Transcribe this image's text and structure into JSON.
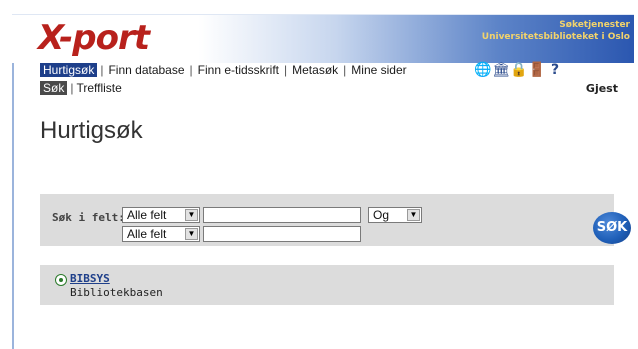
{
  "header": {
    "logo": "X-port",
    "org_line1": "Søketjenester",
    "org_line2": "Universitetsbiblioteket i Oslo"
  },
  "nav": {
    "items": [
      "Hurtigsøk",
      "Finn database",
      "Finn e-tidsskrift",
      "Metasøk",
      "Mine sider"
    ],
    "active": "Hurtigsøk",
    "icons": [
      "globe-icon",
      "library-icon",
      "lock-icon",
      "exit-door-icon",
      "help-icon"
    ]
  },
  "subnav": {
    "items": [
      "Søk",
      "Treffliste"
    ],
    "active": "Søk"
  },
  "user": {
    "status": "Gjest"
  },
  "page": {
    "title": "Hurtigsøk"
  },
  "search": {
    "label": "Søk i felt:",
    "rows": [
      {
        "field": "Alle felt",
        "value": ""
      },
      {
        "field": "Alle felt",
        "value": ""
      }
    ],
    "operator": "Og",
    "button": "SØK"
  },
  "database": {
    "name": "BIBSYS",
    "description": "Bibliotekbasen",
    "selected": true
  },
  "colors": {
    "logo": "#b8211c",
    "header_gradient_end": "#2b57b0",
    "org_text": "#f2d36b",
    "active_tab": "#1e3f8a",
    "panel": "#dcdcdc"
  }
}
